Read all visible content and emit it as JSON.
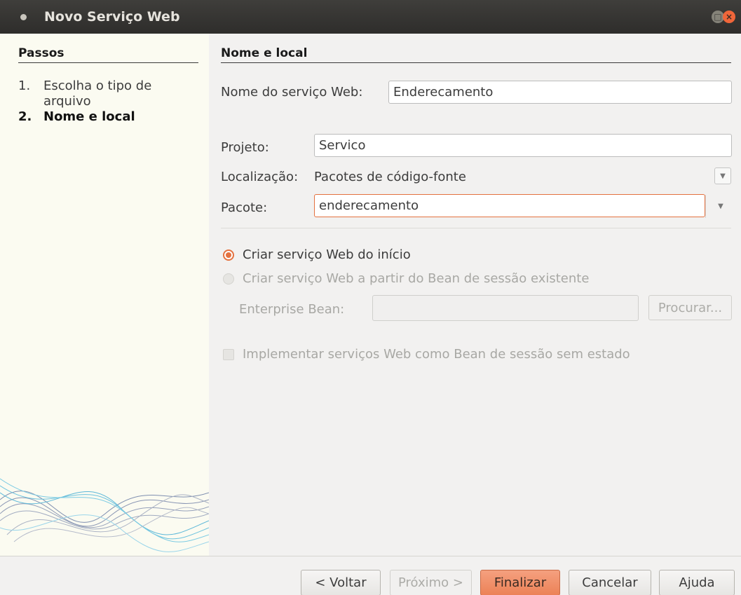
{
  "window": {
    "title": "Novo Serviço Web"
  },
  "steps": {
    "heading": "Passos",
    "items": [
      {
        "num": "1.",
        "label": "Escolha o tipo de arquivo"
      },
      {
        "num": "2.",
        "label": "Nome e local"
      }
    ]
  },
  "form": {
    "section_title": "Nome e local",
    "service_name_label": "Nome do serviço Web:",
    "service_name_value": "Enderecamento",
    "project_label": "Projeto:",
    "project_value": "Servico",
    "location_label": "Localização:",
    "location_value": "Pacotes de código-fonte",
    "package_label": "Pacote:",
    "package_value": "enderecamento",
    "radio_from_scratch": "Criar serviço Web do início",
    "radio_from_bean": "Criar serviço Web a partir do Bean de sessão existente",
    "enterprise_bean_label": "Enterprise Bean:",
    "enterprise_bean_value": "",
    "browse_button": "Procurar...",
    "stateless_checkbox": "Implementar serviços Web como Bean de sessão sem estado"
  },
  "buttons": {
    "back": "< Voltar",
    "next": "Próximo >",
    "finish": "Finalizar",
    "cancel": "Cancelar",
    "help": "Ajuda"
  },
  "colors": {
    "accent": "#e4713f",
    "titlebar": "#3c3b37",
    "sidebar_bg": "#fbfbf1"
  }
}
